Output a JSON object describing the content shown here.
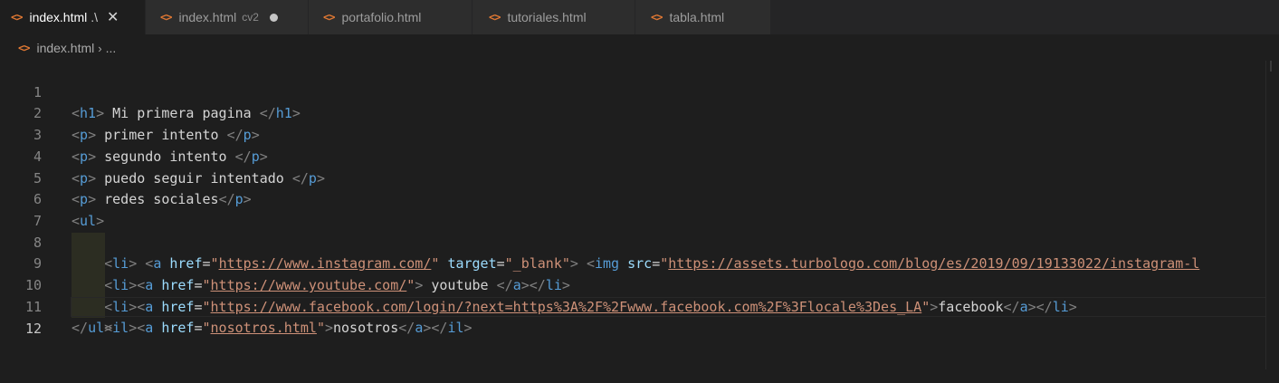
{
  "tabs": [
    {
      "label": "index.html",
      "desc": ".\\",
      "active": true,
      "close": "✕"
    },
    {
      "label": "index.html",
      "desc": "cv2",
      "active": false,
      "dirty": true
    },
    {
      "label": "portafolio.html",
      "desc": "",
      "active": false
    },
    {
      "label": "tutoriales.html",
      "desc": "",
      "active": false
    },
    {
      "label": "tabla.html",
      "desc": "",
      "active": false
    }
  ],
  "breadcrumb": {
    "file": "index.html",
    "more": "..."
  },
  "file_icon": "html-file-icon",
  "colors": {
    "editor_bg": "#1e1e1e",
    "tag": "#569cd6",
    "attr": "#9cdcfe",
    "string": "#ce9178",
    "bracket": "#808080",
    "file_icon": "#e37933"
  },
  "line_numbers": [
    "1",
    "2",
    "3",
    "4",
    "5",
    "6",
    "7",
    "8",
    "9",
    "10",
    "11",
    "12"
  ],
  "current_line": 12,
  "code": {
    "l1": {
      "o1": "<",
      "tag1": "h1",
      "c1": ">",
      "text": " Mi primera pagina ",
      "o2": "</",
      "tag2": "h1",
      "c2": ">"
    },
    "l2": {
      "o1": "<",
      "tag1": "p",
      "c1": ">",
      "text": " primer intento ",
      "o2": "</",
      "tag2": "p",
      "c2": ">"
    },
    "l3": {
      "o1": "<",
      "tag1": "p",
      "c1": ">",
      "text": " segundo intento ",
      "o2": "</",
      "tag2": "p",
      "c2": ">"
    },
    "l4": {
      "o1": "<",
      "tag1": "p",
      "c1": ">",
      "text": " puedo seguir intentado ",
      "o2": "</",
      "tag2": "p",
      "c2": ">"
    },
    "l5": {
      "o1": "<",
      "tag1": "p",
      "c1": ">",
      "text": " redes sociales",
      "o2": "</",
      "tag2": "p",
      "c2": ">"
    },
    "l6": {
      "o1": "<",
      "tag1": "ul",
      "c1": ">"
    },
    "l7": {
      "indent": "    ",
      "o1": "<",
      "tag1": "li",
      "c1": ">",
      "sp1": " ",
      "o2": "<",
      "tag2": "a",
      "sp2": " ",
      "attr1": "href",
      "eq1": "=",
      "q1": "\"",
      "val1": "https://www.instagram.com/",
      "q2": "\"",
      "sp3": " ",
      "attr2": "target",
      "eq2": "=",
      "val2": "\"_blank\"",
      "c2": ">",
      "sp4": " ",
      "o3": "<",
      "tag3": "img",
      "sp5": " ",
      "attr3": "src",
      "eq3": "=",
      "q3": "\"",
      "val3": "https://assets.turbologo.com/blog/es/2019/09/19133022/instagram-l"
    },
    "l8": {
      "indent": "    ",
      "o1": "<",
      "tag1": "li",
      "c1": ">",
      "o2": "<",
      "tag2": "a",
      "sp1": " ",
      "attr1": "href",
      "eq1": "=",
      "q1": "\"",
      "val1": "https://www.youtube.com/",
      "q2": "\"",
      "c2": ">",
      "text": " youtube ",
      "o3": "</",
      "tag3": "a",
      "c3": ">",
      "o4": "</",
      "tag4": "li",
      "c4": ">"
    },
    "l9": {
      "indent": "    ",
      "o1": "<",
      "tag1": "li",
      "c1": ">",
      "o2": "<",
      "tag2": "a",
      "sp1": " ",
      "attr1": "href",
      "eq1": "=",
      "q1": "\"",
      "val1": "https://www.facebook.com/login/?next=https%3A%2F%2Fwww.facebook.com%2F%3Flocale%3Des_LA",
      "q2": "\"",
      "c2": ">",
      "text": "facebook",
      "o3": "</",
      "tag3": "a",
      "c3": ">",
      "o4": "</",
      "tag4": "li",
      "c4": ">"
    },
    "l10": {
      "indent": "    ",
      "o1": "<",
      "tag1": "il",
      "c1": ">",
      "o2": "<",
      "tag2": "a",
      "sp1": " ",
      "attr1": "href",
      "eq1": "=",
      "q1": "\"",
      "val1": "nosotros.html",
      "q2": "\"",
      "c2": ">",
      "text": "nosotros",
      "o3": "</",
      "tag3": "a",
      "c3": ">",
      "o4": "</",
      "tag4": "il",
      "c4": ">"
    },
    "l11": {
      "o1": "</",
      "tag1": "ul",
      "c1": ">"
    }
  }
}
